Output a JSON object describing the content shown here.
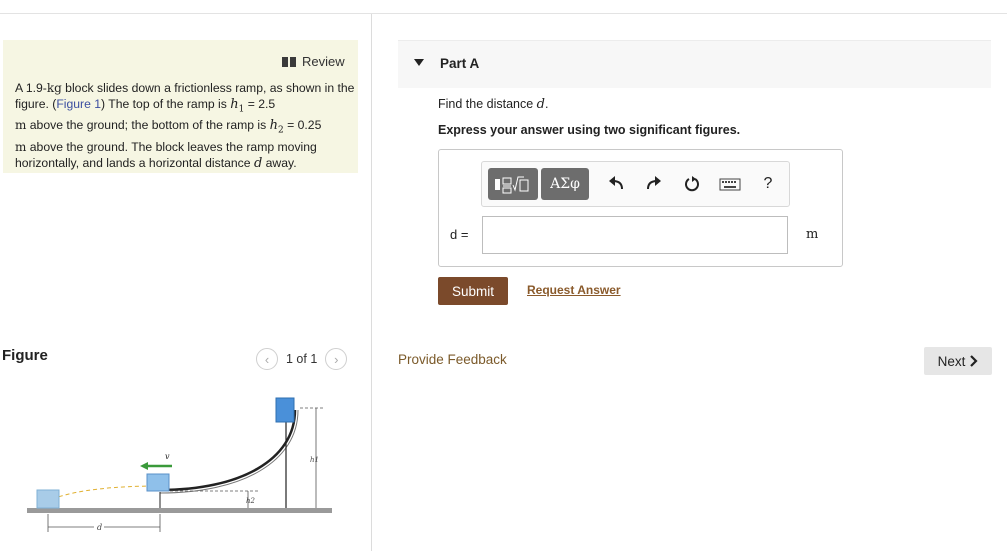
{
  "review": {
    "label": "Review",
    "icon": "book-icon"
  },
  "problem": {
    "intro": "A 1.9-",
    "mass_unit": "kg",
    "text1": " block slides down a frictionless ramp, as shown in the figure. (",
    "figure_link": "Figure 1",
    "text2": ") The top of the ramp is ",
    "h1_symbol": "h",
    "h1_sub": "1",
    "h1_value": " = 2.5",
    "unit_m1": "m",
    "text3": " above the ground; the bottom of the ramp is ",
    "h2_symbol": "h",
    "h2_sub": "2",
    "h2_value": " = 0.25",
    "unit_m2": "m",
    "text4": " above the ground. The block leaves the ramp moving horizontally, and lands a horizontal distance ",
    "d_symbol": "d",
    "text5": " away."
  },
  "figure": {
    "heading": "Figure",
    "pager_text": "1 of 1",
    "prev_icon": "chevron-left-icon",
    "next_icon": "chevron-right-icon",
    "labels": {
      "h1": "h1",
      "h2": "h2",
      "d": "d",
      "v": "v"
    }
  },
  "part": {
    "title": "Part A",
    "find_prefix": "Find the distance ",
    "find_symbol": "d",
    "find_suffix": ".",
    "instruction": "Express your answer using two significant figures."
  },
  "toolbar": {
    "templates_label": "templates-icon",
    "greek_label": "ΑΣφ",
    "undo_icon": "undo-icon",
    "redo_icon": "redo-icon",
    "reset_icon": "reset-icon",
    "keyboard_icon": "keyboard-icon",
    "help_label": "?"
  },
  "answer": {
    "label": "d =",
    "value": "",
    "unit": "m"
  },
  "actions": {
    "submit": "Submit",
    "request_answer": "Request Answer",
    "feedback": "Provide Feedback",
    "next": "Next"
  },
  "colors": {
    "problem_bg": "#f6f6e3",
    "submit_bg": "#7b4a2b",
    "link": "#8a5a2b",
    "ramp_block": "#5aa0e0",
    "velocity_arrow": "#3a9a3a",
    "trajectory": "#e0b030"
  }
}
